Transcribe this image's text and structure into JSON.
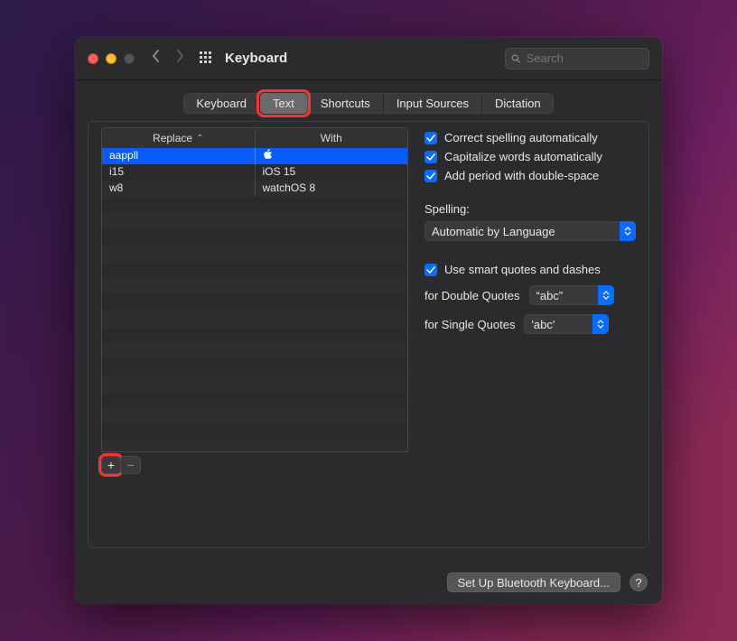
{
  "window": {
    "title": "Keyboard",
    "search_placeholder": "Search"
  },
  "tabs": [
    {
      "label": "Keyboard",
      "active": false
    },
    {
      "label": "Text",
      "active": true
    },
    {
      "label": "Shortcuts",
      "active": false
    },
    {
      "label": "Input Sources",
      "active": false
    },
    {
      "label": "Dictation",
      "active": false
    }
  ],
  "replacements": {
    "columns": {
      "replace": "Replace",
      "with": "With"
    },
    "sort_column": "replace",
    "rows": [
      {
        "replace": "aappll",
        "with": "",
        "selected": true
      },
      {
        "replace": "i15",
        "with": "iOS 15",
        "selected": false
      },
      {
        "replace": "w8",
        "with": "watchOS 8",
        "selected": false
      }
    ]
  },
  "options": {
    "correct_spelling": {
      "label": "Correct spelling automatically",
      "checked": true
    },
    "capitalize_words": {
      "label": "Capitalize words automatically",
      "checked": true
    },
    "double_space_period": {
      "label": "Add period with double-space",
      "checked": true
    },
    "spelling_label": "Spelling:",
    "spelling_value": "Automatic by Language",
    "smart_quotes": {
      "label": "Use smart quotes and dashes",
      "checked": true
    },
    "double_quotes_label": "for Double Quotes",
    "double_quotes_value": "“abc”",
    "single_quotes_label": "for Single Quotes",
    "single_quotes_value": "'abc'"
  },
  "footer": {
    "bluetooth_button": "Set Up Bluetooth Keyboard...",
    "help_glyph": "?"
  },
  "glyphs": {
    "add": "+",
    "remove": "−"
  }
}
